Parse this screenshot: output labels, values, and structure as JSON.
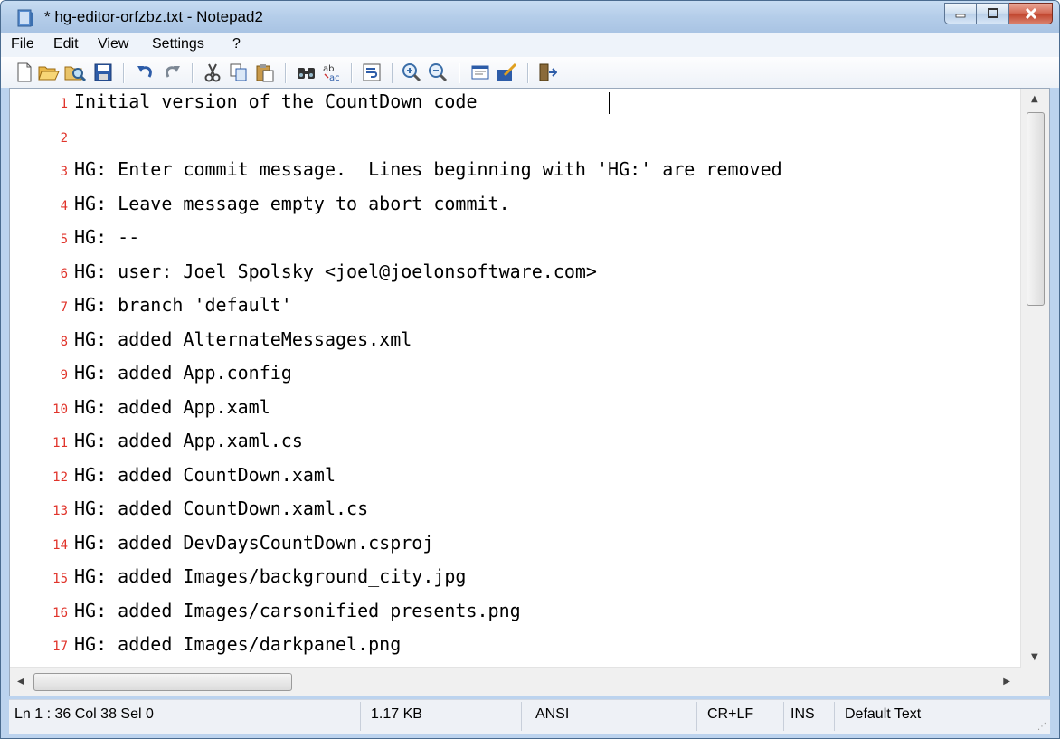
{
  "window": {
    "title": "* hg-editor-orfzbz.txt - Notepad2"
  },
  "menu": [
    "File",
    "Edit",
    "View",
    "Settings",
    "?"
  ],
  "toolbar": {
    "groups": [
      [
        "new-file-icon",
        "open-folder-icon",
        "browse-icon",
        "save-icon"
      ],
      [
        "undo-icon",
        "redo-icon"
      ],
      [
        "cut-icon",
        "copy-icon",
        "paste-icon"
      ],
      [
        "find-icon",
        "replace-icon"
      ],
      [
        "word-wrap-icon"
      ],
      [
        "zoom-in-icon",
        "zoom-out-icon"
      ],
      [
        "scheme-icon",
        "customize-icon"
      ],
      [
        "exit-icon"
      ]
    ]
  },
  "editor": {
    "lines": [
      {
        "num": "1",
        "text": "Initial version of the CountDown code"
      },
      {
        "num": "2",
        "text": ""
      },
      {
        "num": "3",
        "text": "HG: Enter commit message.  Lines beginning with 'HG:' are removed"
      },
      {
        "num": "4",
        "text": "HG: Leave message empty to abort commit."
      },
      {
        "num": "5",
        "text": "HG: --"
      },
      {
        "num": "6",
        "text": "HG: user: Joel Spolsky <joel@joelonsoftware.com>"
      },
      {
        "num": "7",
        "text": "HG: branch 'default'"
      },
      {
        "num": "8",
        "text": "HG: added AlternateMessages.xml"
      },
      {
        "num": "9",
        "text": "HG: added App.config"
      },
      {
        "num": "10",
        "text": "HG: added App.xaml"
      },
      {
        "num": "11",
        "text": "HG: added App.xaml.cs"
      },
      {
        "num": "12",
        "text": "HG: added CountDown.xaml"
      },
      {
        "num": "13",
        "text": "HG: added CountDown.xaml.cs"
      },
      {
        "num": "14",
        "text": "HG: added DevDaysCountDown.csproj"
      },
      {
        "num": "15",
        "text": "HG: added Images/background_city.jpg"
      },
      {
        "num": "16",
        "text": "HG: added Images/carsonified_presents.png"
      },
      {
        "num": "17",
        "text": "HG: added Images/darkpanel.png"
      }
    ]
  },
  "status": {
    "position": "Ln 1 : 36   Col 38   Sel 0",
    "size": "1.17 KB",
    "encoding": "ANSI",
    "line_endings": "CR+LF",
    "mode": "INS",
    "scheme": "Default Text"
  },
  "colors": {
    "line_number": "#e0342b",
    "title_bar": "#b4cde9",
    "close_button": "#c0432c"
  }
}
